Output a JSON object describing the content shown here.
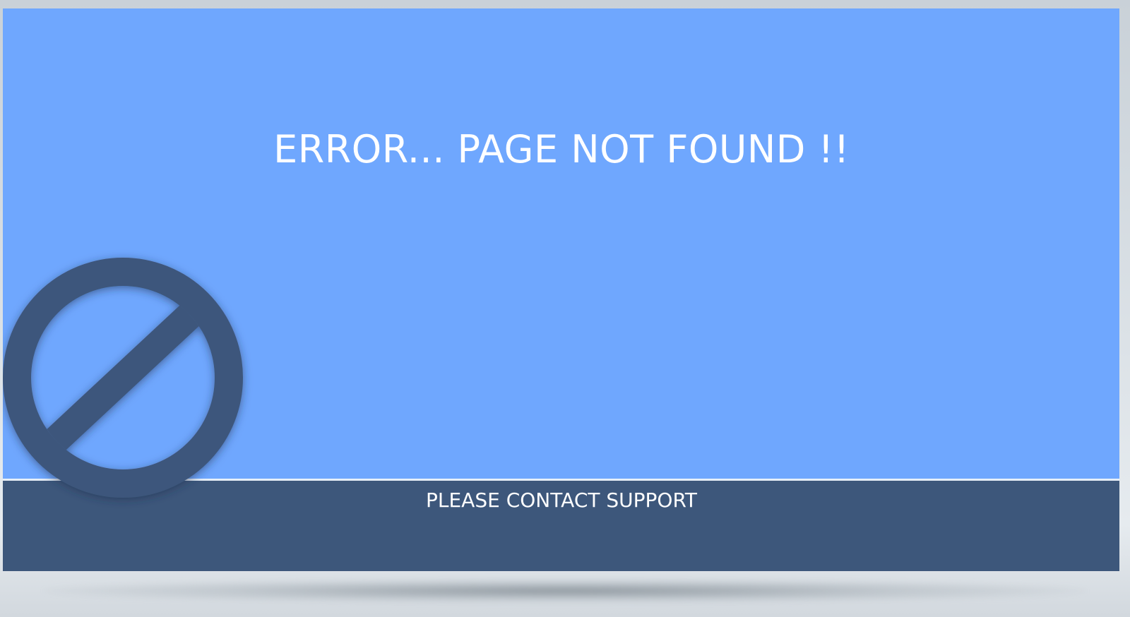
{
  "error": {
    "title": "ERROR... PAGE NOT FOUND !!",
    "support_label": "PLEASE CONTACT SUPPORT"
  },
  "icon": {
    "name": "prohibited-icon"
  },
  "colors": {
    "top_panel": "#6fa7fe",
    "bottom_bar": "#3d577b",
    "icon": "#3d577b",
    "text": "#ffffff"
  }
}
